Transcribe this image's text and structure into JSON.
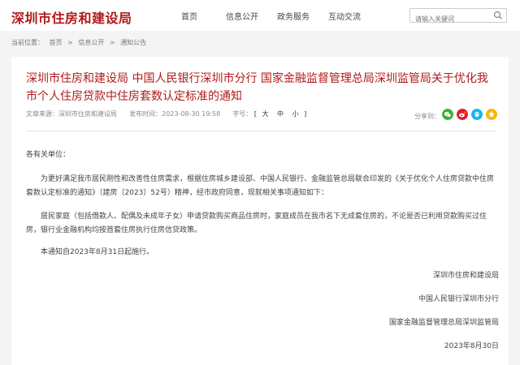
{
  "header": {
    "logo": "深圳市住房和建设局",
    "nav": [
      "首页",
      "信息公开",
      "政务服务",
      "互动交流"
    ],
    "search_placeholder": "请输入关键词"
  },
  "breadcrumb": {
    "label": "当前位置：",
    "items": [
      "首页",
      "信息公开",
      "通知公告"
    ],
    "separator": ">"
  },
  "article": {
    "title": "深圳市住房和建设局 中国人民银行深圳市分行 国家金融监督管理总局深圳监管局关于优化我市个人住房贷款中住房套数认定标准的通知",
    "meta": {
      "source_label": "文章来源：",
      "source": "深圳市住房和建设局",
      "date_label": "发布时间：",
      "date": "2023-08-30 19:58",
      "font_label": "字号：",
      "font_open": "[",
      "font_sizes": [
        "大",
        "中",
        "小"
      ],
      "font_close": "]"
    },
    "share_label": "分享到：",
    "share_icons": [
      "wechat-icon",
      "weibo-icon",
      "qq-icon",
      "qzone-icon"
    ],
    "salutation": "各有关单位：",
    "paragraphs": [
      "为更好满足我市居民刚性和改善性住房需求，根据住房城乡建设部、中国人民银行、金融监管总局联合印发的《关于优化个人住房贷款中住房套数认定标准的通知》（建房〔2023〕52号）精神，经市政府同意，现就相关事项通知如下：",
      "居民家庭（包括借款人、配偶及未成年子女）申请贷款购买商品住房时，家庭成员在我市名下无成套住房的，不论是否已利用贷款购买过住房，银行业金融机构均按首套住房执行住房信贷政策。",
      "本通知自2023年8月31日起施行。"
    ],
    "signatures": [
      "深圳市住房和建设局",
      "中国人民银行深圳市分行",
      "国家金融监督管理总局深圳监管局",
      "2023年8月30日"
    ]
  },
  "colors": {
    "brand_red": "#b11a1a",
    "wechat": "#3cb034",
    "weibo": "#e6162d",
    "qq": "#12b7f5",
    "qzone": "#f6b40e"
  }
}
